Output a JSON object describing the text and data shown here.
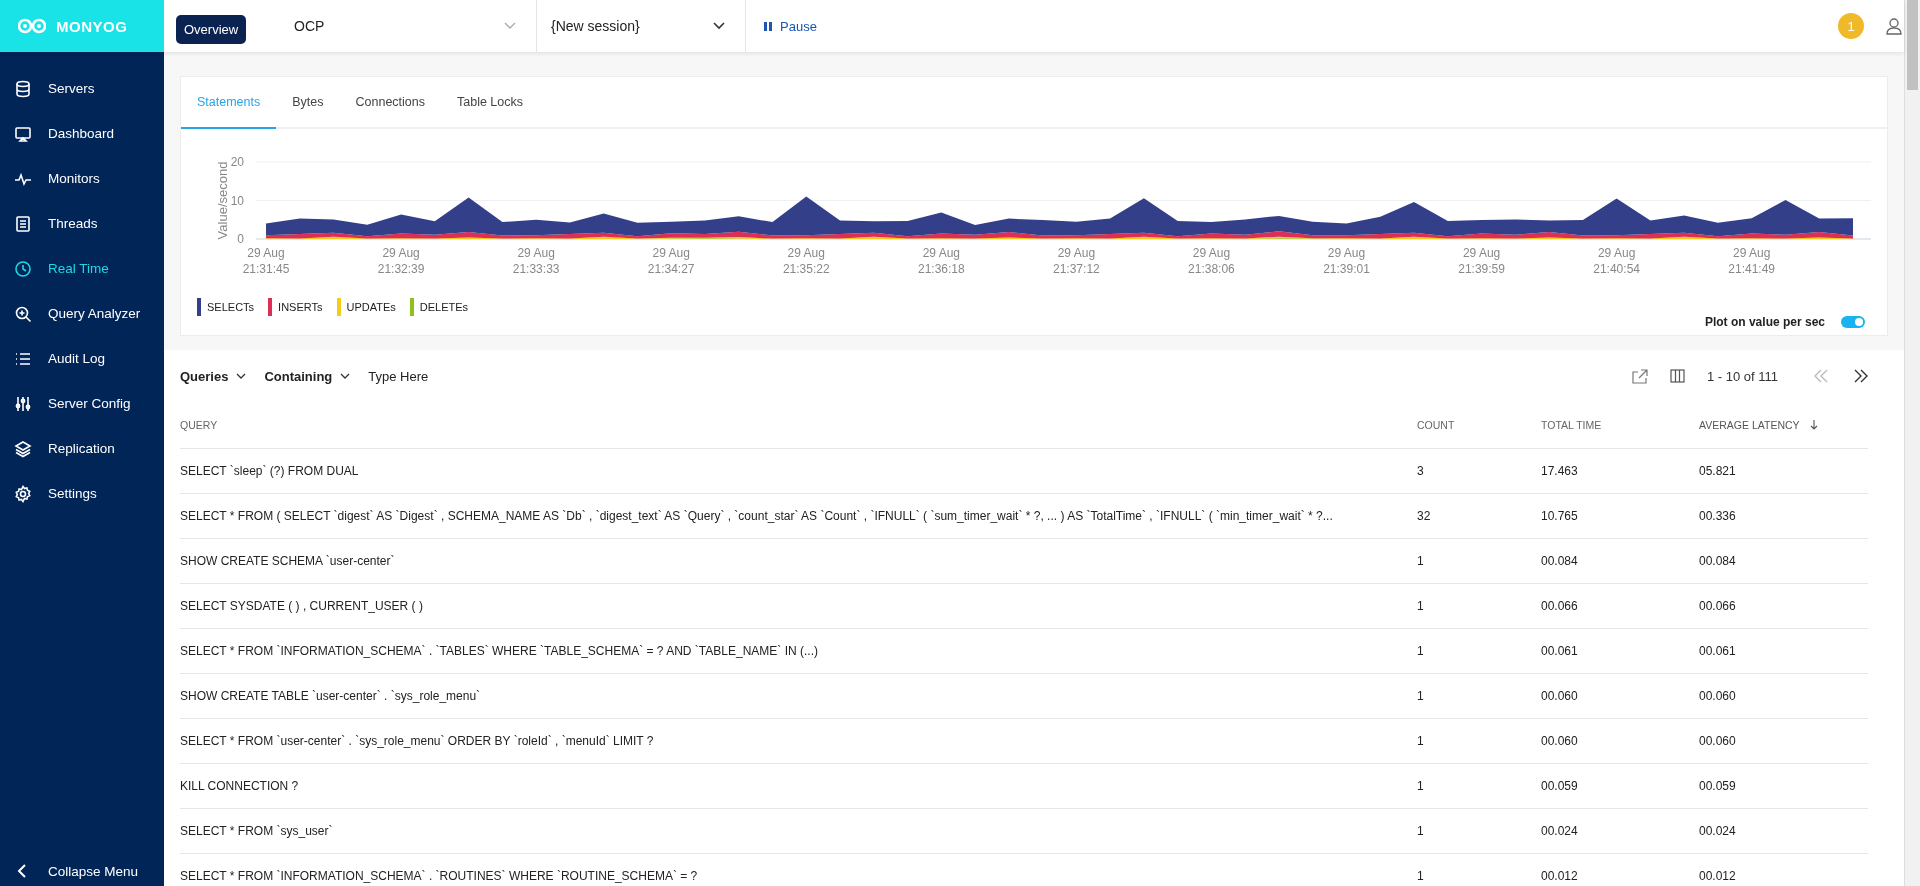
{
  "app": {
    "logo": "MONYOG",
    "tooltip": "Overview"
  },
  "topbar": {
    "server_select": {
      "value": "OCP"
    },
    "session_select": {
      "value": "{New session}"
    },
    "pause_button": {
      "label": "Pause"
    },
    "notification_count": "1"
  },
  "sidebar": {
    "items": [
      {
        "label": "Servers",
        "selected": false
      },
      {
        "label": "Dashboard",
        "selected": false
      },
      {
        "label": "Monitors",
        "selected": false
      },
      {
        "label": "Threads",
        "selected": false
      },
      {
        "label": "Real Time",
        "selected": true
      },
      {
        "label": "Query Analyzer",
        "selected": false
      },
      {
        "label": "Audit Log",
        "selected": false
      },
      {
        "label": "Server Config",
        "selected": false
      },
      {
        "label": "Replication",
        "selected": false
      },
      {
        "label": "Settings",
        "selected": false
      }
    ],
    "collapse": "Collapse Menu"
  },
  "chart_panel": {
    "tabs": [
      {
        "label": "Statements",
        "selected": true
      },
      {
        "label": "Bytes",
        "selected": false
      },
      {
        "label": "Connections",
        "selected": false
      },
      {
        "label": "Table Locks",
        "selected": false
      }
    ],
    "chart_data": {
      "type": "area",
      "ylabel": "Value/second",
      "stacked": true,
      "ylim": [
        0,
        20
      ],
      "yticks": [
        0,
        10,
        20
      ],
      "categories": [
        "29 Aug 21:31:45",
        null,
        null,
        null,
        "29 Aug 21:32:39",
        null,
        null,
        null,
        "29 Aug 21:33:33",
        null,
        null,
        null,
        "29 Aug 21:34:27",
        null,
        null,
        null,
        "29 Aug 21:35:22",
        null,
        null,
        null,
        "29 Aug 21:36:18",
        null,
        null,
        null,
        "29 Aug 21:37:12",
        null,
        null,
        null,
        "29 Aug 21:38:06",
        null,
        null,
        null,
        "29 Aug 21:39:01",
        null,
        null,
        null,
        "29 Aug 21:39:59",
        null,
        null,
        null,
        "29 Aug 21:40:54",
        null,
        null,
        null,
        "29 Aug 21:41:49",
        null,
        null,
        null
      ],
      "series": [
        {
          "name": "DELETEs",
          "color": "#8cc21b",
          "values": [
            0,
            0,
            0,
            0,
            0,
            0,
            0,
            0,
            0,
            0,
            0,
            0,
            0.1,
            0.2,
            0.1,
            0,
            0,
            0,
            0,
            0,
            0,
            0,
            0,
            0,
            0,
            0,
            0,
            0,
            0,
            0,
            0.2,
            0.1,
            0,
            0,
            0,
            0,
            0,
            0,
            0,
            0,
            0,
            0,
            0,
            0,
            0,
            0,
            0,
            0
          ]
        },
        {
          "name": "UPDATEs",
          "color": "#f5cd19",
          "values": [
            0.2,
            0.1,
            0.6,
            0.1,
            0.2,
            0.1,
            0.4,
            0.1,
            0.2,
            0.1,
            0.6,
            0.1,
            0.2,
            0.1,
            0.4,
            0.1,
            0.2,
            0.1,
            0.6,
            0.1,
            0.2,
            0.1,
            0.4,
            0.1,
            0.2,
            0.1,
            0.6,
            0.1,
            0.2,
            0.1,
            0.4,
            0.1,
            0.2,
            0.1,
            0.6,
            0.1,
            0.2,
            0.1,
            0.4,
            0.1,
            0.2,
            0.1,
            0.6,
            0.1,
            0.2,
            0.1,
            0.4,
            0.1
          ]
        },
        {
          "name": "INSERTs",
          "color": "#dc2f55",
          "values": [
            0.8,
            1.2,
            1,
            0.6,
            1.2,
            1,
            1.4,
            0.8,
            0.8,
            1.2,
            1,
            0.6,
            1.2,
            1,
            1.4,
            0.8,
            0.8,
            1.2,
            1,
            0.6,
            1.2,
            1,
            1.4,
            0.8,
            0.8,
            1.2,
            1,
            0.6,
            1.2,
            1,
            1.4,
            0.8,
            0.8,
            1.2,
            1,
            0.6,
            1.2,
            1,
            1.4,
            0.8,
            0.8,
            1.2,
            1,
            0.6,
            1.2,
            1,
            1.4,
            0.8
          ]
        },
        {
          "name": "SELECTs",
          "color": "#343f8a",
          "values": [
            3,
            4,
            3.5,
            3,
            5,
            3.5,
            9,
            3.5,
            4,
            3,
            5,
            3.5,
            3,
            3.5,
            4,
            3.5,
            10,
            3.5,
            3,
            4,
            5.5,
            2.5,
            3.5,
            4,
            3.5,
            4,
            9,
            4,
            3,
            4,
            4,
            3.5,
            3,
            4.5,
            8,
            4,
            3.5,
            4,
            3,
            4,
            9.5,
            3.5,
            4.5,
            3.5,
            4,
            9,
            3.5,
            4.5
          ]
        }
      ]
    },
    "plot_toggle": {
      "label": "Plot on value per sec",
      "on": true
    }
  },
  "queries": {
    "filters": [
      {
        "label": "Queries"
      },
      {
        "label": "Containing"
      }
    ],
    "search": {
      "placeholder": "Type Here"
    },
    "pagination": {
      "range": "1 - 10 of 111",
      "prev_disabled": true,
      "next_disabled": false
    },
    "columns": [
      {
        "label": "QUERY",
        "sorted": false
      },
      {
        "label": "COUNT",
        "sorted": false
      },
      {
        "label": "TOTAL TIME",
        "sorted": false
      },
      {
        "label": "AVERAGE LATENCY",
        "sorted": true
      }
    ],
    "rows": [
      [
        "SELECT `sleep` (?) FROM DUAL",
        "3",
        "17.463",
        "05.821"
      ],
      [
        "SELECT * FROM ( SELECT `digest` AS `Digest` , SCHEMA_NAME AS `Db` , `digest_text` AS `Query` , `count_star` AS `Count` , `IFNULL` ( `sum_timer_wait` * ?, ... ) AS `TotalTime` , `IFNULL` ( `min_timer_wait` * ?...",
        "32",
        "10.765",
        "00.336"
      ],
      [
        "SHOW CREATE SCHEMA `user-center`",
        "1",
        "00.084",
        "00.084"
      ],
      [
        "SELECT SYSDATE ( ) , CURRENT_USER ( )",
        "1",
        "00.066",
        "00.066"
      ],
      [
        "SELECT * FROM `INFORMATION_SCHEMA` . `TABLES` WHERE `TABLE_SCHEMA` = ? AND `TABLE_NAME` IN (...)",
        "1",
        "00.061",
        "00.061"
      ],
      [
        "SHOW CREATE TABLE `user-center` . `sys_role_menu`",
        "1",
        "00.060",
        "00.060"
      ],
      [
        "SELECT * FROM `user-center` . `sys_role_menu` ORDER BY `roleId` , `menuId` LIMIT ?",
        "1",
        "00.060",
        "00.060"
      ],
      [
        "KILL CONNECTION ?",
        "1",
        "00.059",
        "00.059"
      ],
      [
        "SELECT * FROM `sys_user`",
        "1",
        "00.024",
        "00.024"
      ],
      [
        "SELECT * FROM `INFORMATION_SCHEMA` . `ROUTINES` WHERE `ROUTINE_SCHEMA` = ?",
        "1",
        "00.012",
        "00.012"
      ]
    ]
  }
}
